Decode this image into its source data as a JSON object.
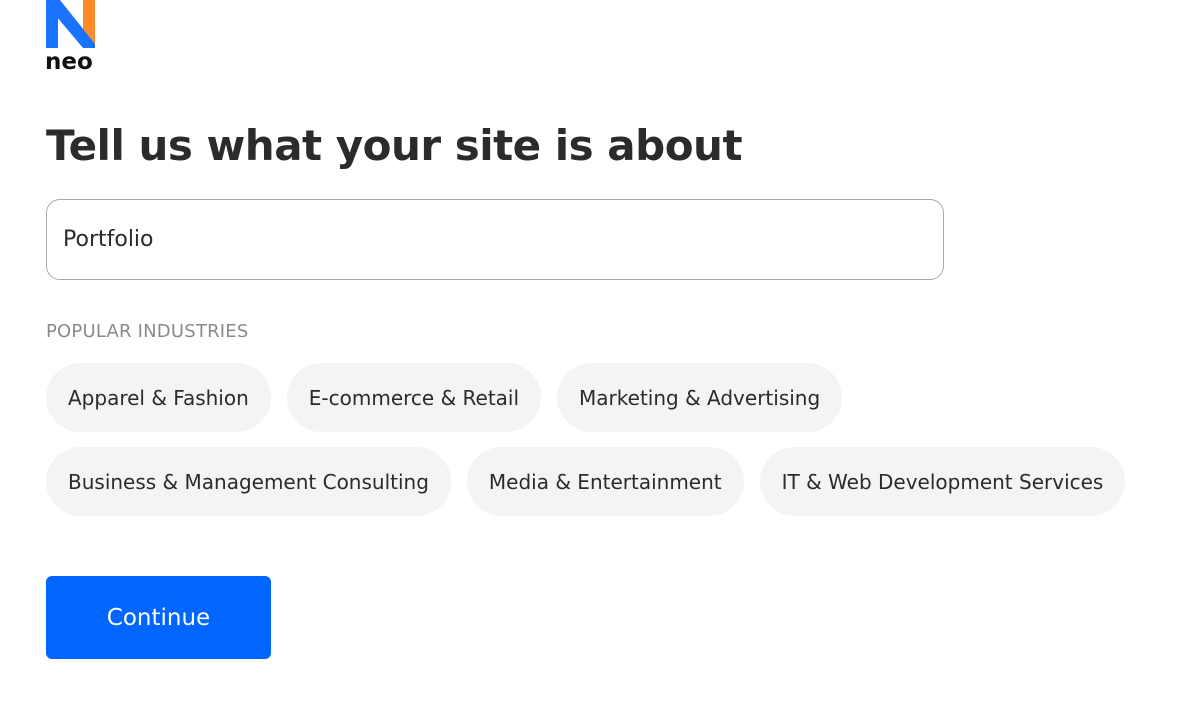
{
  "brand": {
    "name": "neo",
    "logo_icon": "neo-logo-icon",
    "colors": {
      "blue": "#1a73ff",
      "orange": "#ff8a2a"
    }
  },
  "page": {
    "title": "Tell us what your site is about"
  },
  "site_input": {
    "value": "Portfolio"
  },
  "popular_industries": {
    "label": "POPULAR INDUSTRIES",
    "rows": [
      [
        "Apparel & Fashion",
        "E-commerce & Retail",
        "Marketing & Advertising"
      ],
      [
        "Business & Management Consulting",
        "Media & Entertainment",
        "IT & Web Development Services"
      ]
    ]
  },
  "actions": {
    "continue_label": "Continue",
    "accent_color": "#0066ff"
  }
}
